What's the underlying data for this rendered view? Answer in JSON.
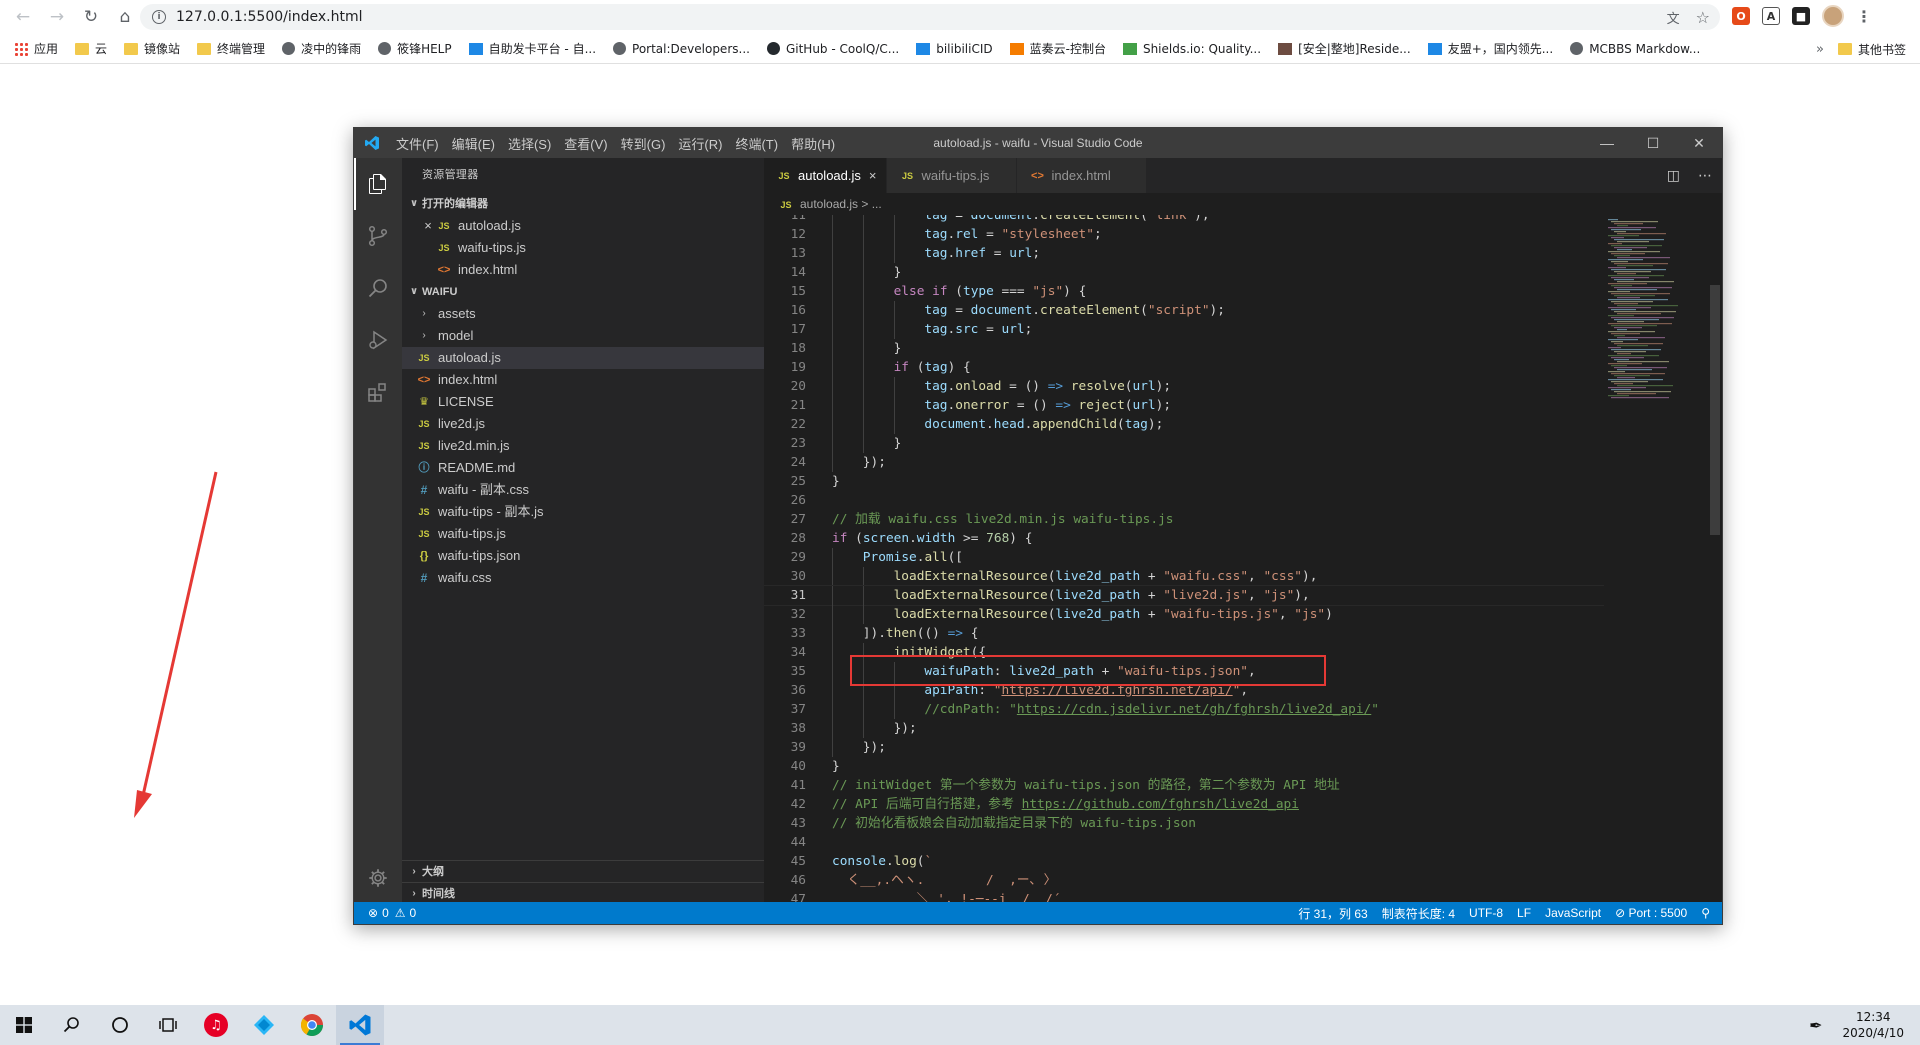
{
  "browser": {
    "url": "127.0.0.1:5500/index.html",
    "bookmarks": [
      {
        "label": "应用",
        "icon": "grid"
      },
      {
        "label": "云",
        "icon": "folder"
      },
      {
        "label": "镜像站",
        "icon": "folder"
      },
      {
        "label": "终端管理",
        "icon": "folder"
      },
      {
        "label": "凌中的锋雨",
        "icon": "globe"
      },
      {
        "label": "筱锋HELP",
        "icon": "globe"
      },
      {
        "label": "自助发卡平台 - 自...",
        "icon": "blue"
      },
      {
        "label": "Portal:Developers...",
        "icon": "globe"
      },
      {
        "label": "GitHub - CoolQ/C...",
        "icon": "dark"
      },
      {
        "label": "bilibiliCID",
        "icon": "blue"
      },
      {
        "label": "蓝奏云-控制台",
        "icon": "orange"
      },
      {
        "label": "Shields.io: Quality...",
        "icon": "green"
      },
      {
        "label": "[安全|整地]Reside...",
        "icon": "brown"
      },
      {
        "label": "友盟+，国内领先...",
        "icon": "blue"
      },
      {
        "label": "MCBBS Markdow...",
        "icon": "globe"
      }
    ],
    "more_label": "»",
    "other_bookmarks": "其他书签"
  },
  "vscode": {
    "title": "autoload.js - waifu - Visual Studio Code",
    "menus": [
      "文件(F)",
      "编辑(E)",
      "选择(S)",
      "查看(V)",
      "转到(G)",
      "运行(R)",
      "终端(T)",
      "帮助(H)"
    ],
    "explorer_title": "资源管理器",
    "open_editors_title": "打开的编辑器",
    "open_editors": [
      {
        "name": "autoload.js",
        "type": "js",
        "closable": true
      },
      {
        "name": "waifu-tips.js",
        "type": "js"
      },
      {
        "name": "index.html",
        "type": "html"
      }
    ],
    "folder_title": "WAIFU",
    "files": [
      {
        "name": "assets",
        "type": "folder"
      },
      {
        "name": "model",
        "type": "folder"
      },
      {
        "name": "autoload.js",
        "type": "js",
        "selected": true
      },
      {
        "name": "index.html",
        "type": "html"
      },
      {
        "name": "LICENSE",
        "type": "lic"
      },
      {
        "name": "live2d.js",
        "type": "js"
      },
      {
        "name": "live2d.min.js",
        "type": "js"
      },
      {
        "name": "README.md",
        "type": "md"
      },
      {
        "name": "waifu - 副本.css",
        "type": "css"
      },
      {
        "name": "waifu-tips - 副本.js",
        "type": "js"
      },
      {
        "name": "waifu-tips.js",
        "type": "js"
      },
      {
        "name": "waifu-tips.json",
        "type": "json"
      },
      {
        "name": "waifu.css",
        "type": "css"
      }
    ],
    "outline_title": "大纲",
    "timeline_title": "时间线",
    "tabs": [
      {
        "name": "autoload.js",
        "type": "js",
        "active": true
      },
      {
        "name": "waifu-tips.js",
        "type": "js"
      },
      {
        "name": "index.html",
        "type": "html"
      }
    ],
    "breadcrumb": "autoload.js > ...",
    "code_lines": [
      {
        "n": 11,
        "indent": 3,
        "html": "<span class=\"v\">tag</span> = <span class=\"v\">document</span>.<span class=\"f\">createElement</span>(<span class=\"s\">\"link\"</span>);"
      },
      {
        "n": 12,
        "indent": 3,
        "html": "<span class=\"v\">tag</span>.<span class=\"v\">rel</span> = <span class=\"s\">\"stylesheet\"</span>;"
      },
      {
        "n": 13,
        "indent": 3,
        "html": "<span class=\"v\">tag</span>.<span class=\"v\">href</span> = <span class=\"v\">url</span>;"
      },
      {
        "n": 14,
        "indent": 2,
        "html": "}"
      },
      {
        "n": 15,
        "indent": 2,
        "html": "<span class=\"kc\">else</span> <span class=\"kc\">if</span> (<span class=\"v\">type</span> === <span class=\"s\">\"js\"</span>) {"
      },
      {
        "n": 16,
        "indent": 3,
        "html": "<span class=\"v\">tag</span> = <span class=\"v\">document</span>.<span class=\"f\">createElement</span>(<span class=\"s\">\"script\"</span>);"
      },
      {
        "n": 17,
        "indent": 3,
        "html": "<span class=\"v\">tag</span>.<span class=\"v\">src</span> = <span class=\"v\">url</span>;"
      },
      {
        "n": 18,
        "indent": 2,
        "html": "}"
      },
      {
        "n": 19,
        "indent": 2,
        "html": "<span class=\"kc\">if</span> (<span class=\"v\">tag</span>) {"
      },
      {
        "n": 20,
        "indent": 3,
        "html": "<span class=\"v\">tag</span>.<span class=\"f\">onload</span> = () <span class=\"k\">=&gt;</span> <span class=\"f\">resolve</span>(<span class=\"v\">url</span>);"
      },
      {
        "n": 21,
        "indent": 3,
        "html": "<span class=\"v\">tag</span>.<span class=\"f\">onerror</span> = () <span class=\"k\">=&gt;</span> <span class=\"f\">reject</span>(<span class=\"v\">url</span>);"
      },
      {
        "n": 22,
        "indent": 3,
        "html": "<span class=\"v\">document</span>.<span class=\"v\">head</span>.<span class=\"f\">appendChild</span>(<span class=\"v\">tag</span>);"
      },
      {
        "n": 23,
        "indent": 2,
        "html": "}"
      },
      {
        "n": 24,
        "indent": 1,
        "html": "});"
      },
      {
        "n": 25,
        "indent": 0,
        "html": "}"
      },
      {
        "n": 26,
        "indent": 0,
        "html": ""
      },
      {
        "n": 27,
        "indent": 0,
        "html": "<span class=\"c\">// 加载 waifu.css live2d.min.js waifu-tips.js</span>"
      },
      {
        "n": 28,
        "indent": 0,
        "html": "<span class=\"kc\">if</span> (<span class=\"v\">screen</span>.<span class=\"v\">width</span> &gt;= <span class=\"n\">768</span>) {"
      },
      {
        "n": 29,
        "indent": 1,
        "html": "<span class=\"v\">Promise</span>.<span class=\"f\">all</span>(["
      },
      {
        "n": 30,
        "indent": 2,
        "html": "<span class=\"f\">loadExternalResource</span>(<span class=\"v\">live2d_path</span> + <span class=\"s\">\"waifu.css\"</span>, <span class=\"s\">\"css\"</span>),"
      },
      {
        "n": 31,
        "indent": 2,
        "html": "<span class=\"f\">loadExternalResource</span>(<span class=\"v\">live2d_path</span> + <span class=\"s\">\"live2d.js\"</span>, <span class=\"s\">\"js\"</span>),",
        "current": true
      },
      {
        "n": 32,
        "indent": 2,
        "html": "<span class=\"f\">loadExternalResource</span>(<span class=\"v\">live2d_path</span> + <span class=\"s\">\"waifu-tips.js\"</span>, <span class=\"s\">\"js\"</span>)"
      },
      {
        "n": 33,
        "indent": 1,
        "html": "]).<span class=\"f\">then</span>(() <span class=\"k\">=&gt;</span> {"
      },
      {
        "n": 34,
        "indent": 2,
        "html": "<span class=\"f\">initWidget</span>({"
      },
      {
        "n": 35,
        "indent": 3,
        "html": "<span class=\"v\">waifuPath</span>: <span class=\"v\">live2d_path</span> + <span class=\"s\">\"waifu-tips.json\"</span>,"
      },
      {
        "n": 36,
        "indent": 3,
        "html": "<span class=\"v\">apiPath</span>: <span class=\"s\">\"</span><span class=\"u\">https://live2d.fghrsh.net/api/</span><span class=\"s\">\"</span>,"
      },
      {
        "n": 37,
        "indent": 3,
        "html": "<span class=\"c\">//cdnPath: \"</span><span class=\"cu\">https://cdn.jsdelivr.net/gh/fghrsh/live2d_api/</span><span class=\"c\">\"</span>"
      },
      {
        "n": 38,
        "indent": 2,
        "html": "});"
      },
      {
        "n": 39,
        "indent": 1,
        "html": "});"
      },
      {
        "n": 40,
        "indent": 0,
        "html": "}"
      },
      {
        "n": 41,
        "indent": 0,
        "html": "<span class=\"c\">// initWidget 第一个参数为 waifu-tips.json 的路径，第二个参数为 API 地址</span>"
      },
      {
        "n": 42,
        "indent": 0,
        "html": "<span class=\"c\">// API 后端可自行搭建，参考 </span><span class=\"cu\">https://github.com/fghrsh/live2d_api</span>"
      },
      {
        "n": 43,
        "indent": 0,
        "html": "<span class=\"c\">// 初始化看板娘会自动加载指定目录下的 waifu-tips.json</span>"
      },
      {
        "n": 44,
        "indent": 0,
        "html": ""
      },
      {
        "n": 45,
        "indent": 0,
        "html": "<span class=\"v\">console</span>.<span class=\"f\">log</span>(<span class=\"s\">`</span>"
      },
      {
        "n": 46,
        "indent": 0,
        "html": "<span class=\"s\">  く__,.ヘヽ.        /  ,ー､ 〉</span>"
      },
      {
        "n": 47,
        "indent": 0,
        "html": "<span class=\"s\">           ＼ ', !-─‐-i  /  /´</span>"
      }
    ],
    "status": {
      "errors": "0",
      "warnings": "0",
      "position": "行 31，列 63",
      "tab_size": "制表符长度: 4",
      "encoding": "UTF-8",
      "eol": "LF",
      "language": "JavaScript",
      "port": "Port : 5500"
    }
  },
  "taskbar": {
    "time": "12:34",
    "date": "2020/4/10"
  },
  "colors": {
    "statusbar": "#007acc",
    "highlight": "#e53935",
    "arrow": "#e53935"
  }
}
